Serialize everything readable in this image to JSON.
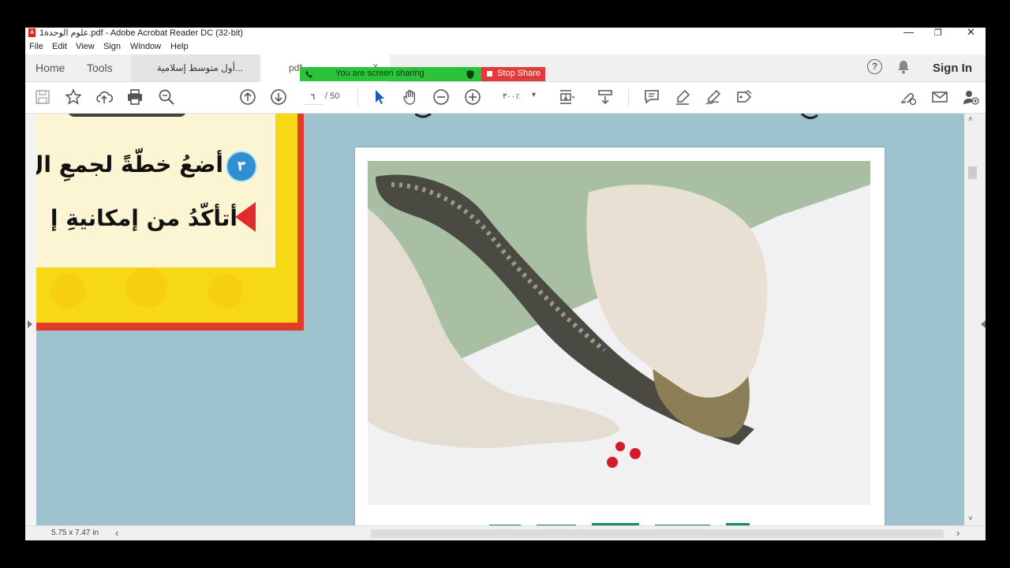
{
  "window": {
    "title": "علوم الوحدة1.pdf - Adobe Acrobat Reader DC (32-bit)",
    "pdf_icon": "A"
  },
  "window_controls": {
    "minimize": "—",
    "restore": "❐",
    "close": "✕"
  },
  "menu": [
    "File",
    "Edit",
    "View",
    "Sign",
    "Window",
    "Help"
  ],
  "tabs": {
    "home": "Home",
    "tools": "Tools",
    "doc1": "أول متوسط إسلامية...",
    "doc2": "pdf",
    "close": "×"
  },
  "header_right": {
    "help": "?",
    "sign_in": "Sign In"
  },
  "toolbar": {
    "page_current": "٦",
    "page_total": "/ 50",
    "zoom": "٣٠٠٪",
    "zoom_dropdown": "▾"
  },
  "share": {
    "status": "You are screen sharing",
    "stop": "Stop Share"
  },
  "document": {
    "line1": "أضعُ خطّةً لجمعِ ال",
    "line2": "أتأكّدُ من إمكانيةِ إ",
    "step_number": "٣"
  },
  "status": {
    "page_size": "5.75 x 7.47 in",
    "scroll_left": "‹",
    "scroll_right": "›"
  },
  "scroll": {
    "up": "˄",
    "down": "˅"
  },
  "colors": {
    "accent_red": "#e23b2c",
    "yellow": "#f7d814",
    "share_green": "#2bc33a",
    "share_red": "#e23b3b",
    "page_bg": "#9ec3ce"
  }
}
